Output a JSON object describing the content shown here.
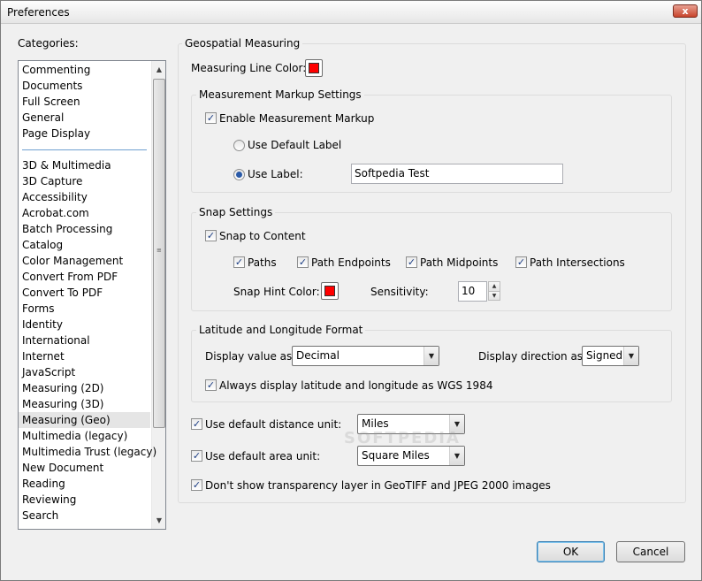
{
  "window": {
    "title": "Preferences",
    "close_glyph": "x"
  },
  "categories": {
    "label": "Categories:",
    "group1": [
      "Commenting",
      "Documents",
      "Full Screen",
      "General",
      "Page Display"
    ],
    "group2": [
      "3D & Multimedia",
      "3D Capture",
      "Accessibility",
      "Acrobat.com",
      "Batch Processing",
      "Catalog",
      "Color Management",
      "Convert From PDF",
      "Convert To PDF",
      "Forms",
      "Identity",
      "International",
      "Internet",
      "JavaScript",
      "Measuring (2D)",
      "Measuring (3D)",
      "Measuring (Geo)",
      "Multimedia (legacy)",
      "Multimedia Trust (legacy)",
      "New Document",
      "Reading",
      "Reviewing",
      "Search"
    ],
    "selected": "Measuring (Geo)"
  },
  "panel": {
    "title": "Geospatial Measuring",
    "line_color_label": "Measuring Line Color:",
    "line_color": "#ff0000",
    "markup": {
      "title": "Measurement Markup Settings",
      "enable_label": "Enable Measurement Markup",
      "enable_checked": true,
      "default_label": "Use Default Label",
      "use_label": "Use Label:",
      "label_value": "Softpedia Test",
      "selected_option": "Use Label"
    },
    "snap": {
      "title": "Snap Settings",
      "snap_content_label": "Snap to Content",
      "paths_label": "Paths",
      "endpoints_label": "Path Endpoints",
      "midpoints_label": "Path Midpoints",
      "intersections_label": "Path Intersections",
      "hint_color_label": "Snap Hint Color:",
      "hint_color": "#ff0000",
      "sensitivity_label": "Sensitivity:",
      "sensitivity_value": "10"
    },
    "latlong": {
      "title": "Latitude and Longitude Format",
      "display_value_label": "Display value as:",
      "display_value": "Decimal",
      "direction_label": "Display direction as:",
      "direction_value": "Signed",
      "wgs_label": "Always display latitude and longitude as WGS 1984"
    },
    "distance_label": "Use default distance unit:",
    "distance_value": "Miles",
    "area_label": "Use default area unit:",
    "area_value": "Square Miles",
    "transparency_label": "Don't show transparency layer in GeoTIFF and JPEG 2000 images"
  },
  "buttons": {
    "ok": "OK",
    "cancel": "Cancel"
  },
  "watermark": "SOFTPEDIA"
}
